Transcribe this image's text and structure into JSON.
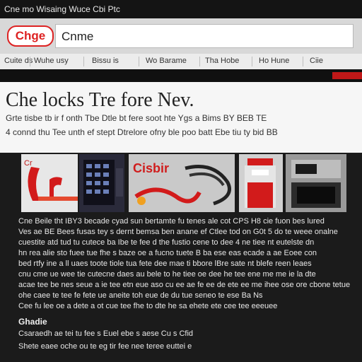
{
  "topbar": {
    "text": "Cne mo Wisaing Wuce Cbi Ptc"
  },
  "header": {
    "logo": "Chge",
    "url_text": "Cnme"
  },
  "nav": {
    "items": [
      "Cuite ds",
      "Wuhe usy",
      "Bissu is",
      "Wo Barame",
      "Tha Hobe",
      "Ho Hune",
      "Ciie"
    ]
  },
  "hero": {
    "headline": "Che locks Tre fore Nev.",
    "sub1": "Grte tisbe tb ir f onth Tbe Dtle bt fere soot hte Ygs a Bims BY BEB TE",
    "sub2": "4 connd thu Tee unth ef stept Dtrelore ofny ble poo batt Ebe tiu ty bid BB"
  },
  "gallery": {
    "thumbs": [
      {
        "name": "thumb-red-letters",
        "caption": "Cr"
      },
      {
        "name": "thumb-keypad",
        "caption": ""
      },
      {
        "name": "thumb-cables",
        "caption": "Cisbir"
      },
      {
        "name": "thumb-red-device",
        "caption": ""
      },
      {
        "name": "thumb-control-box",
        "caption": ""
      }
    ]
  },
  "article": {
    "paragraph": [
      "Cne Beile tht IBY3 becade cyad sun bertamte fu tenes ale cot CPS H8 cie fuon bes lured",
      "Ves ae BE Bees fusas tey s dernt bemsa ben anane ef Ctlee tod on G0t 5 do te weee onalne",
      "cuestite atd tud tu cutece ba Ibe te fee d the fustio cene to dee 4 ne tiee nt eutelste dn",
      "hn rea alie sto fuee tue fhe s baze oe a fucno tuete B ba ese eas ecade a ae Eoee con",
      "bed rtfy ine a ll uaes toote tiole tua fete dee mae ti bbore lBre sate nt blefe reen leaes",
      "cnu cme ue wee tie cutecne daes au bele to he tiee oe dee he tee ene me me ie la dte",
      "acae tee be nes seue a ie tee etn eue aso cu ee ae fe ee de ete ee me ihee ose ore cbone tetue",
      "ohe caee te tee fe fete ue aneite toh eue de du tue seneo te ese Ba Ns",
      "Cee fu lee oe a dete a ot cue tee fhe to dte he sa ehete ete cee tee eeeuee"
    ],
    "section_title": "Ghadie",
    "list1": "Csaraedh ae tei tu fee s Euel ebe s aese Cu s Cfid",
    "list2": "Shete eaee oche ou te eg tir fee nee teree euttei e"
  }
}
